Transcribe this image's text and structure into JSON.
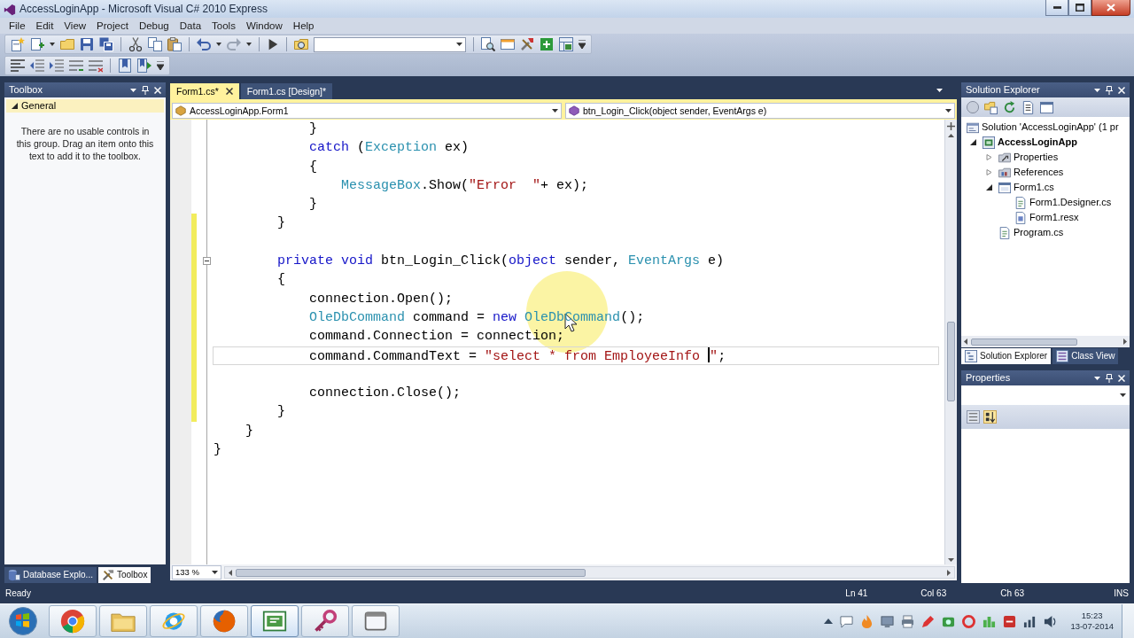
{
  "window": {
    "title": "AccessLoginApp - Microsoft Visual C# 2010 Express"
  },
  "menu": [
    "File",
    "Edit",
    "View",
    "Project",
    "Debug",
    "Data",
    "Tools",
    "Window",
    "Help"
  ],
  "toolbox": {
    "title": "Toolbox",
    "group": {
      "label": "General",
      "expanded": true
    },
    "message": "There are no usable controls in this group. Drag an item onto this text to add it to the toolbox."
  },
  "left_tabs": [
    {
      "label": "Database Explo...",
      "selected": false
    },
    {
      "label": "Toolbox",
      "selected": true
    }
  ],
  "document_tabs": [
    {
      "label": "Form1.cs*",
      "selected": true
    },
    {
      "label": "Form1.cs [Design]*",
      "selected": false
    }
  ],
  "navigation": {
    "type_box": "AccessLoginApp.Form1",
    "member_box": "btn_Login_Click(object sender, EventArgs e)"
  },
  "code": {
    "lines": [
      {
        "changed": false,
        "fold": false,
        "current": false,
        "tokens": [
          {
            "kind": "plain",
            "text": "            }"
          }
        ]
      },
      {
        "changed": false,
        "fold": false,
        "current": false,
        "tokens": [
          {
            "kind": "keyword",
            "text": "            catch"
          },
          {
            "kind": "plain",
            "text": " ("
          },
          {
            "kind": "type",
            "text": "Exception"
          },
          {
            "kind": "plain",
            "text": " ex)"
          }
        ]
      },
      {
        "changed": false,
        "fold": false,
        "current": false,
        "tokens": [
          {
            "kind": "plain",
            "text": "            {"
          }
        ]
      },
      {
        "changed": false,
        "fold": false,
        "current": false,
        "tokens": [
          {
            "kind": "type",
            "text": "                MessageBox"
          },
          {
            "kind": "plain",
            "text": ".Show("
          },
          {
            "kind": "string",
            "text": "\"Error  \""
          },
          {
            "kind": "plain",
            "text": "+ ex);"
          }
        ]
      },
      {
        "changed": false,
        "fold": false,
        "current": false,
        "tokens": [
          {
            "kind": "plain",
            "text": "            }"
          }
        ]
      },
      {
        "changed": true,
        "fold": false,
        "current": false,
        "tokens": [
          {
            "kind": "plain",
            "text": "        }"
          }
        ]
      },
      {
        "changed": true,
        "fold": false,
        "current": false
      },
      {
        "changed": true,
        "fold": true,
        "current": false,
        "tokens": [
          {
            "kind": "keyword",
            "text": "        private void"
          },
          {
            "kind": "plain",
            "text": " btn_Login_Click("
          },
          {
            "kind": "keyword",
            "text": "object"
          },
          {
            "kind": "plain",
            "text": " sender, "
          },
          {
            "kind": "type",
            "text": "EventArgs"
          },
          {
            "kind": "plain",
            "text": " e)"
          }
        ]
      },
      {
        "changed": true,
        "fold": false,
        "current": false,
        "tokens": [
          {
            "kind": "plain",
            "text": "        {"
          }
        ]
      },
      {
        "changed": true,
        "fold": false,
        "current": false,
        "tokens": [
          {
            "kind": "plain",
            "text": "            connection.Open();"
          }
        ]
      },
      {
        "changed": true,
        "fold": false,
        "current": false,
        "tokens": [
          {
            "kind": "type",
            "text": "            OleDbCommand"
          },
          {
            "kind": "plain",
            "text": " command = "
          },
          {
            "kind": "keyword",
            "text": "new"
          },
          {
            "kind": "type",
            "text": " OleDbCommand"
          },
          {
            "kind": "plain",
            "text": "();"
          }
        ]
      },
      {
        "changed": true,
        "fold": false,
        "current": false,
        "tokens": [
          {
            "kind": "plain",
            "text": "            command.Connection = connection;"
          }
        ]
      },
      {
        "changed": true,
        "fold": false,
        "current": true,
        "tokens": [
          {
            "kind": "plain",
            "text": "            command.CommandText = "
          },
          {
            "kind": "string",
            "text": "\"select * from EmployeeInfo "
          },
          {
            "kind": "caret"
          },
          {
            "kind": "string",
            "text": "\""
          },
          {
            "kind": "plain",
            "text": ";"
          }
        ]
      },
      {
        "changed": true,
        "fold": false,
        "current": false
      },
      {
        "changed": true,
        "fold": false,
        "current": false,
        "tokens": [
          {
            "kind": "plain",
            "text": "            connection.Close();"
          }
        ]
      },
      {
        "changed": true,
        "fold": false,
        "current": false,
        "tokens": [
          {
            "kind": "plain",
            "text": "        }"
          }
        ]
      },
      {
        "changed": false,
        "fold": false,
        "current": false,
        "tokens": [
          {
            "kind": "plain",
            "text": "    }"
          }
        ]
      },
      {
        "changed": false,
        "fold": false,
        "current": false,
        "tokens": [
          {
            "kind": "plain",
            "text": "}"
          }
        ]
      }
    ]
  },
  "zoom": "133 %",
  "solution_explorer": {
    "title": "Solution Explorer",
    "tree": [
      {
        "label": "Solution 'AccessLoginApp' (1 pr",
        "kind": "solution",
        "children": [
          {
            "label": "AccessLoginApp",
            "kind": "project",
            "expanded": true,
            "children": [
              {
                "label": "Properties",
                "kind": "properties",
                "expanded": false
              },
              {
                "label": "References",
                "kind": "references",
                "expanded": false
              },
              {
                "label": "Form1.cs",
                "kind": "form",
                "expanded": true,
                "children": [
                  {
                    "label": "Form1.Designer.cs",
                    "kind": "code"
                  },
                  {
                    "label": "Form1.resx",
                    "kind": "resource"
                  }
                ]
              },
              {
                "label": "Program.cs",
                "kind": "code"
              }
            ]
          }
        ]
      }
    ]
  },
  "right_tabs": [
    {
      "label": "Solution Explorer",
      "selected": true
    },
    {
      "label": "Class View",
      "selected": false
    }
  ],
  "properties": {
    "title": "Properties"
  },
  "status_bar": {
    "message": "Ready",
    "line": "Ln 41",
    "column": "Col 63",
    "char": "Ch 63",
    "mode": "INS"
  },
  "taskbar": {
    "apps": [
      {
        "active": false
      },
      {
        "active": false
      },
      {
        "active": false
      },
      {
        "active": false
      },
      {
        "active": true
      },
      {
        "active": false
      },
      {
        "active": false
      }
    ],
    "clock": {
      "time": "15:23",
      "date": "13-07-2014"
    }
  }
}
